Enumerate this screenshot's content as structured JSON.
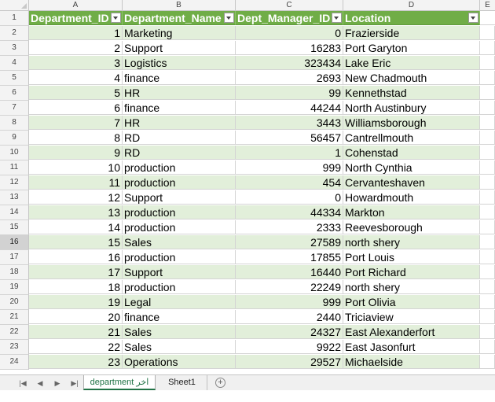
{
  "column_letters": [
    "A",
    "B",
    "C",
    "D",
    "E"
  ],
  "header_row": {
    "row_number": "1",
    "cells": [
      "Department_ID",
      "Department_Name",
      "Dept_Manager_ID",
      "Location"
    ]
  },
  "data_rows": [
    {
      "row_number": "2",
      "id": "1",
      "name": "Marketing",
      "manager": "0",
      "location": "Frazierside"
    },
    {
      "row_number": "3",
      "id": "2",
      "name": "Support",
      "manager": "16283",
      "location": "Port Garyton"
    },
    {
      "row_number": "4",
      "id": "3",
      "name": "Logistics",
      "manager": "323434",
      "location": "Lake Eric"
    },
    {
      "row_number": "5",
      "id": "4",
      "name": "finance",
      "manager": "2693",
      "location": "New Chadmouth"
    },
    {
      "row_number": "6",
      "id": "5",
      "name": "HR",
      "manager": "99",
      "location": "Kennethstad"
    },
    {
      "row_number": "7",
      "id": "6",
      "name": "finance",
      "manager": "44244",
      "location": "North Austinbury"
    },
    {
      "row_number": "8",
      "id": "7",
      "name": "HR",
      "manager": "3443",
      "location": "Williamsborough"
    },
    {
      "row_number": "9",
      "id": "8",
      "name": "RD",
      "manager": "56457",
      "location": "Cantrellmouth"
    },
    {
      "row_number": "10",
      "id": "9",
      "name": "RD",
      "manager": "1",
      "location": "Cohenstad"
    },
    {
      "row_number": "11",
      "id": "10",
      "name": "production",
      "manager": "999",
      "location": "North Cynthia"
    },
    {
      "row_number": "12",
      "id": "11",
      "name": "production",
      "manager": "454",
      "location": "Cervanteshaven"
    },
    {
      "row_number": "13",
      "id": "12",
      "name": "Support",
      "manager": "0",
      "location": "Howardmouth"
    },
    {
      "row_number": "14",
      "id": "13",
      "name": "production",
      "manager": "44334",
      "location": "Markton"
    },
    {
      "row_number": "15",
      "id": "14",
      "name": "production",
      "manager": "2333",
      "location": "Reevesborough"
    },
    {
      "row_number": "16",
      "id": "15",
      "name": "Sales",
      "manager": "27589",
      "location": "north shery"
    },
    {
      "row_number": "17",
      "id": "16",
      "name": "production",
      "manager": "17855",
      "location": "Port Louis"
    },
    {
      "row_number": "18",
      "id": "17",
      "name": "Support",
      "manager": "16440",
      "location": "Port Richard"
    },
    {
      "row_number": "19",
      "id": "18",
      "name": "production",
      "manager": "22249",
      "location": "north shery"
    },
    {
      "row_number": "20",
      "id": "19",
      "name": "Legal",
      "manager": "999",
      "location": "Port Olivia"
    },
    {
      "row_number": "21",
      "id": "20",
      "name": "finance",
      "manager": "2440",
      "location": "Triciaview"
    },
    {
      "row_number": "22",
      "id": "21",
      "name": "Sales",
      "manager": "24327",
      "location": "East Alexanderfort"
    },
    {
      "row_number": "23",
      "id": "22",
      "name": "Sales",
      "manager": "9922",
      "location": "East Jasonfurt"
    },
    {
      "row_number": "24",
      "id": "23",
      "name": "Operations",
      "manager": "29527",
      "location": "Michaelside"
    }
  ],
  "selected_row": "16",
  "sheet_tabs": {
    "nav_icons": [
      "first-sheet-icon",
      "prev-sheet-icon",
      "next-sheet-icon",
      "last-sheet-icon"
    ],
    "tabs": [
      "department اخر",
      "Sheet1"
    ],
    "active": "department اخر",
    "add_icon": "plus-circle-icon"
  },
  "colors": {
    "header_fill": "#70ad47",
    "band_fill": "#e2efda",
    "active_tab_accent": "#217346"
  }
}
